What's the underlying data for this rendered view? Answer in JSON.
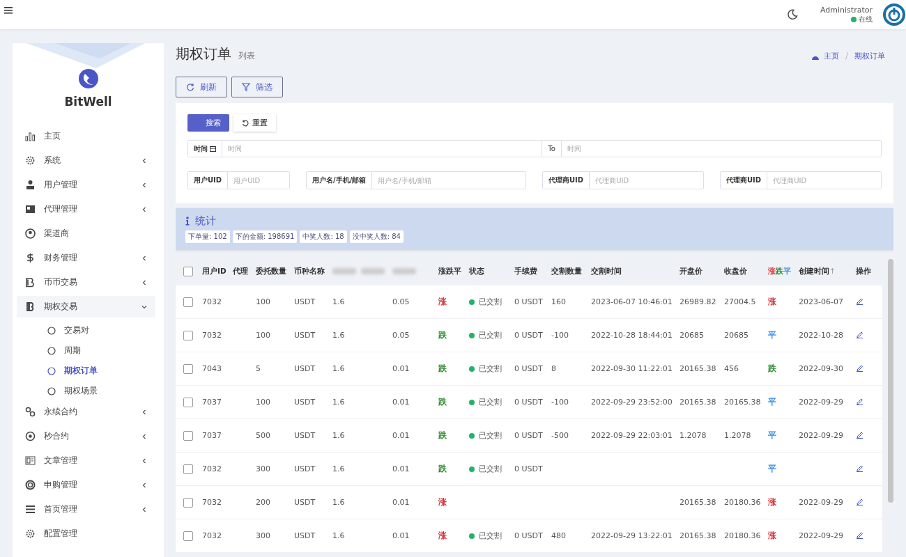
{
  "topbar": {
    "user": "Administrator",
    "status": "在线",
    "online": true
  },
  "sidebar": {
    "brand": "BitWell",
    "items": [
      {
        "label": "主页",
        "has_arrow": false
      },
      {
        "label": "系统",
        "has_arrow": true
      },
      {
        "label": "用户管理",
        "has_arrow": true
      },
      {
        "label": "代理管理",
        "has_arrow": true
      },
      {
        "label": "渠道商",
        "has_arrow": false
      },
      {
        "label": "财务管理",
        "has_arrow": true
      },
      {
        "label": "币币交易",
        "has_arrow": true
      },
      {
        "label": "期权交易",
        "has_arrow": true,
        "expanded": true,
        "children": [
          {
            "label": "交易对",
            "selected": false
          },
          {
            "label": "周期",
            "selected": false
          },
          {
            "label": "期权订单",
            "selected": true
          },
          {
            "label": "期权场景",
            "selected": false
          }
        ]
      },
      {
        "label": "永续合约",
        "has_arrow": true
      },
      {
        "label": "秒合约",
        "has_arrow": true
      },
      {
        "label": "文章管理",
        "has_arrow": true
      },
      {
        "label": "申购管理",
        "has_arrow": true
      },
      {
        "label": "首页管理",
        "has_arrow": true
      },
      {
        "label": "配置管理",
        "has_arrow": false
      }
    ]
  },
  "page": {
    "title": "期权订单",
    "subtitle": "列表",
    "breadcrumb": [
      "主页",
      "期权订单"
    ],
    "breadcrumb_separator": "/"
  },
  "toolbar": [
    "刷新",
    "筛选"
  ],
  "filter": {
    "search_button": "搜索",
    "reset_button": "重置",
    "time": {
      "label": "时间",
      "placeholder": "时间",
      "to_label": "To",
      "to_placeholder": "时间"
    },
    "fields": [
      {
        "label": "用户UID",
        "placeholder": "用户UID"
      },
      {
        "label": "用户名/手机/邮箱",
        "placeholder": "用户名/手机/邮箱"
      },
      {
        "label": "代理商UID",
        "placeholder": "代理商UID"
      },
      {
        "label": "代理商UID",
        "placeholder": "代理商UID"
      }
    ]
  },
  "stats": {
    "title": "统计",
    "badges": [
      "下单量: 102",
      "下的金额: 198691",
      "中奖人数: 18",
      "没中奖人数: 84"
    ]
  },
  "table": {
    "select_all_checked": false,
    "columns": [
      {
        "label": "用户ID"
      },
      {
        "label": "代理"
      },
      {
        "label": "委托数量"
      },
      {
        "label": "币种名称"
      },
      {
        "blurred": true
      },
      {
        "blurred": true
      },
      {
        "blurred": true
      },
      {
        "label": "涨跌平"
      },
      {
        "label": "状态"
      },
      {
        "label": "手续费"
      },
      {
        "label": "交割数量"
      },
      {
        "label": "交割时间"
      },
      {
        "label": "开盘价"
      },
      {
        "label": "收盘价"
      },
      {
        "parts": [
          {
            "text": "涨",
            "color": "#d9363e"
          },
          {
            "text": "跌",
            "color": "#2e8b2e"
          },
          {
            "text": "平",
            "color": "#3a8ee6"
          }
        ]
      },
      {
        "label": "创建时间",
        "sort": "↑"
      },
      {
        "label": "操作"
      }
    ],
    "rows": [
      {
        "checked": false,
        "uid": "7032",
        "qty": "100",
        "coin": "USDT",
        "odds": "1.6",
        "diff": "0.05",
        "dir": {
          "text": "涨",
          "color": "#d9363e"
        },
        "status": "已交割",
        "fee": "0 USDT",
        "settle_qty": "160",
        "settle_time": "2023-06-07 10:46:01",
        "open": "26989.82",
        "close": "27004.5",
        "result": {
          "text": "涨",
          "color": "#d9363e"
        },
        "created": "2023-06-07"
      },
      {
        "checked": false,
        "uid": "7032",
        "qty": "100",
        "coin": "USDT",
        "odds": "1.6",
        "diff": "0.05",
        "dir": {
          "text": "跌",
          "color": "#2e8b2e"
        },
        "status": "已交割",
        "fee": "0 USDT",
        "settle_qty": "-100",
        "settle_time": "2022-10-28 18:44:01",
        "open": "20685",
        "close": "20685",
        "result": {
          "text": "平",
          "color": "#3a8ee6"
        },
        "created": "2022-10-28"
      },
      {
        "checked": false,
        "uid": "7043",
        "qty": "5",
        "coin": "USDT",
        "odds": "1.6",
        "diff": "0.01",
        "dir": {
          "text": "跌",
          "color": "#2e8b2e"
        },
        "status": "已交割",
        "fee": "0 USDT",
        "settle_qty": "8",
        "settle_time": "2022-09-30 11:22:01",
        "open": "20165.38",
        "close": "456",
        "result": {
          "text": "跌",
          "color": "#2e8b2e"
        },
        "created": "2022-09-30"
      },
      {
        "checked": false,
        "uid": "7037",
        "qty": "100",
        "coin": "USDT",
        "odds": "1.6",
        "diff": "0.01",
        "dir": {
          "text": "跌",
          "color": "#2e8b2e"
        },
        "status": "已交割",
        "fee": "0 USDT",
        "settle_qty": "-100",
        "settle_time": "2022-09-29 23:52:00",
        "open": "20165.38",
        "close": "20165.38",
        "result": {
          "text": "平",
          "color": "#3a8ee6"
        },
        "created": "2022-09-29"
      },
      {
        "checked": false,
        "uid": "7037",
        "qty": "500",
        "coin": "USDT",
        "odds": "1.6",
        "diff": "0.01",
        "dir": {
          "text": "跌",
          "color": "#2e8b2e"
        },
        "status": "已交割",
        "fee": "0 USDT",
        "settle_qty": "-500",
        "settle_time": "2022-09-29 22:03:01",
        "open": "1.2078",
        "close": "1.2078",
        "result": {
          "text": "平",
          "color": "#3a8ee6"
        },
        "created": "2022-09-29"
      },
      {
        "checked": false,
        "uid": "7032",
        "qty": "300",
        "coin": "USDT",
        "odds": "1.6",
        "diff": "0.01",
        "dir": {
          "text": "跌",
          "color": "#2e8b2e"
        },
        "status": "已交割",
        "fee": "0 USDT",
        "result": {
          "text": "平",
          "color": "#3a8ee6"
        }
      },
      {
        "checked": false,
        "uid": "7032",
        "qty": "200",
        "coin": "USDT",
        "odds": "1.6",
        "diff": "0.01",
        "dir": {
          "text": "涨",
          "color": "#d9363e"
        },
        "open": "20165.38",
        "close": "20180.36",
        "result": {
          "text": "涨",
          "color": "#d9363e"
        },
        "created": "2022-09-29"
      },
      {
        "checked": false,
        "uid": "7032",
        "qty": "300",
        "coin": "USDT",
        "odds": "1.6",
        "diff": "0.01",
        "dir": {
          "text": "涨",
          "color": "#d9363e"
        },
        "status": "已交割",
        "fee": "0 USDT",
        "settle_qty": "480",
        "settle_time": "2022-09-29 13:22:01",
        "open": "20165.38",
        "close": "20180.36",
        "result": {
          "text": "涨",
          "color": "#d9363e"
        },
        "created": "2022-09-29"
      }
    ]
  }
}
